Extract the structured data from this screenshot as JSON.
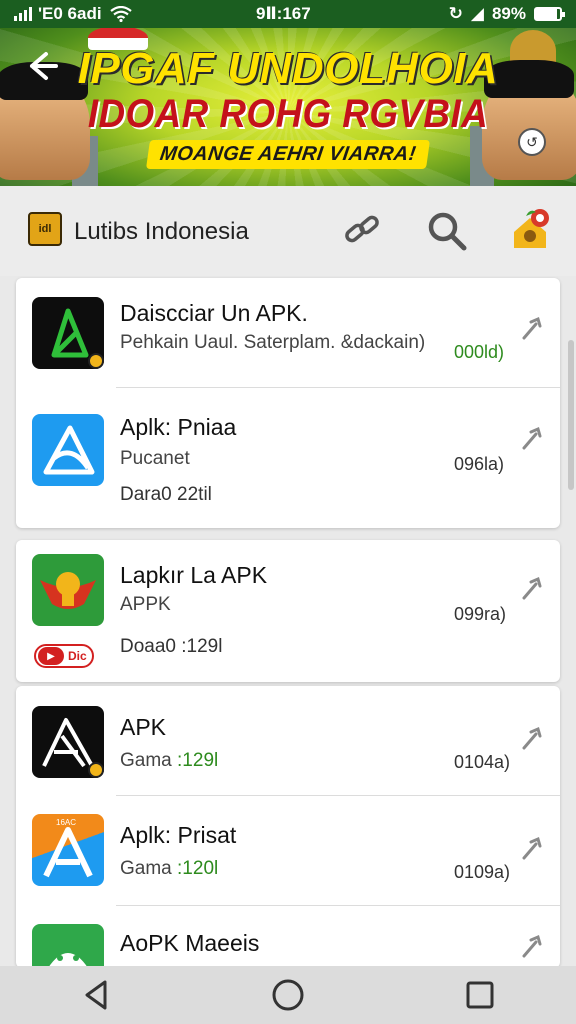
{
  "status_bar": {
    "carrier": "'E0 6adi",
    "time": "9Ⅱ:167",
    "battery": "89%",
    "battery_level": 0.89
  },
  "banner": {
    "line1": "IPGAF UNDOLHOIA",
    "line2": "IDOAR ROHG RGVBIA",
    "line3": "MOANGE AEHRI VIARRA!",
    "colors": {
      "headline1": "#ffe200",
      "headline2": "#c4111b",
      "background": "#b8d628"
    }
  },
  "header": {
    "logo_text": "idl",
    "title": "Lutibs Indonesia",
    "icons": [
      "link-icon",
      "search-icon",
      "avatar-icon"
    ]
  },
  "apps": [
    {
      "name": "Daiscciar Un APK.",
      "sub": "Pehkain Uaul. Saterplam. &dackain)",
      "extra": "",
      "size": "000ld)",
      "size_green": true,
      "icon": "green-triangle-icon"
    },
    {
      "name": "Aplk: Pniaa",
      "sub": "Pucanet",
      "extra": "Dara0 22til",
      "size": "096la)",
      "size_green": false,
      "icon": "blue-triangle-icon"
    },
    {
      "name": "Lapkır La APK",
      "sub": "APPK",
      "extra": "Doaa0 :129l",
      "size": "099ra)",
      "size_green": false,
      "icon": "garuda-icon",
      "badge": "Dic"
    },
    {
      "name": "APK",
      "sub_prefix": "Gama",
      "sub_green": ":129l",
      "extra": "",
      "size": "0104a)",
      "size_green": false,
      "icon": "black-triangle-icon"
    },
    {
      "name": "Aplk: Prisat",
      "sub_prefix": "Gama",
      "sub_green": ":120l",
      "extra": "",
      "size": "0109a)",
      "size_green": false,
      "icon": "orange-blue-triangle-icon",
      "icon_label": "16AC"
    },
    {
      "name": "AoPK Maeeis",
      "sub": "",
      "extra": "",
      "size": "",
      "size_green": false,
      "icon": "android-icon"
    }
  ],
  "nav": {
    "icons": [
      "back-nav-icon",
      "home-nav-icon",
      "recents-nav-icon"
    ]
  }
}
